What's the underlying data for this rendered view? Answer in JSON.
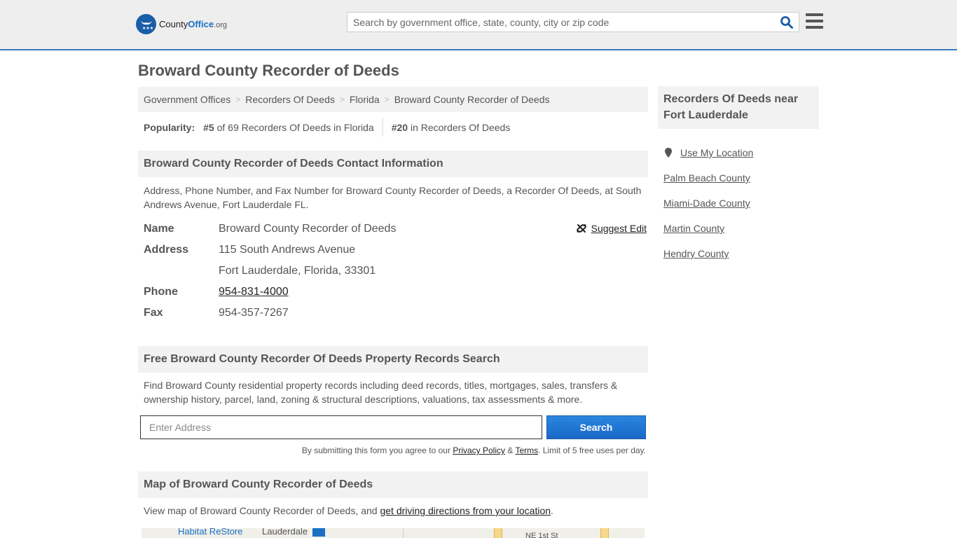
{
  "header": {
    "logo": {
      "county": "County",
      "office": "Office",
      "org": ".org"
    },
    "search_placeholder": "Search by government office, state, county, city or zip code",
    "search_icon": "search-icon",
    "menu_icon": "hamburger-menu-icon"
  },
  "page": {
    "title": "Broward County Recorder of Deeds"
  },
  "breadcrumb": [
    {
      "label": "Government Offices"
    },
    {
      "label": "Recorders Of Deeds"
    },
    {
      "label": "Florida"
    },
    {
      "label": "Broward County Recorder of Deeds"
    }
  ],
  "breadcrumb_separator": ">",
  "popularity": {
    "label": "Popularity:",
    "state_rank": "#5",
    "state_text": "of 69 Recorders Of Deeds in Florida",
    "national_rank": "#20",
    "national_text": "in Recorders Of Deeds"
  },
  "contact": {
    "heading": "Broward County Recorder of Deeds Contact Information",
    "description": "Address, Phone Number, and Fax Number for Broward County Recorder of Deeds, a Recorder Of Deeds, at South Andrews Avenue, Fort Lauderdale FL.",
    "suggest_edit": "Suggest Edit",
    "rows": {
      "name_label": "Name",
      "name_value": "Broward County Recorder of Deeds",
      "address_label": "Address",
      "address_line1": "115 South Andrews Avenue",
      "address_line2": "Fort Lauderdale, Florida, 33301",
      "phone_label": "Phone",
      "phone_value": "954-831-4000",
      "fax_label": "Fax",
      "fax_value": "954-357-7267"
    }
  },
  "property_search": {
    "heading": "Free Broward County Recorder Of Deeds Property Records Search",
    "description": "Find Broward County residential property records including deed records, titles, mortgages, sales, transfers & ownership history, parcel, land, zoning & structural descriptions, valuations, tax assessments & more.",
    "input_placeholder": "Enter Address",
    "button_label": "Search",
    "disclaimer_prefix": "By submitting this form you agree to our ",
    "privacy_link": "Privacy Policy",
    "amp": " & ",
    "terms_link": "Terms",
    "disclaimer_suffix": ". Limit of 5 free uses per day."
  },
  "map_section": {
    "heading": "Map of Broward County Recorder of Deeds",
    "description_prefix": "View map of Broward County Recorder of Deeds, and ",
    "directions_link": "get driving directions from your location",
    "description_suffix": ".",
    "labels": [
      "Habitat ReStore",
      "Lauderdale",
      "NE 1st St"
    ]
  },
  "sidebar": {
    "heading": "Recorders Of Deeds near Fort Lauderdale",
    "use_location": "Use My Location",
    "links": [
      "Palm Beach County",
      "Miami-Dade County",
      "Martin County",
      "Hendry County"
    ]
  },
  "colors": {
    "accent": "#1a6fc4",
    "header_border": "#3a7ab5",
    "button": "#1a68c7"
  }
}
